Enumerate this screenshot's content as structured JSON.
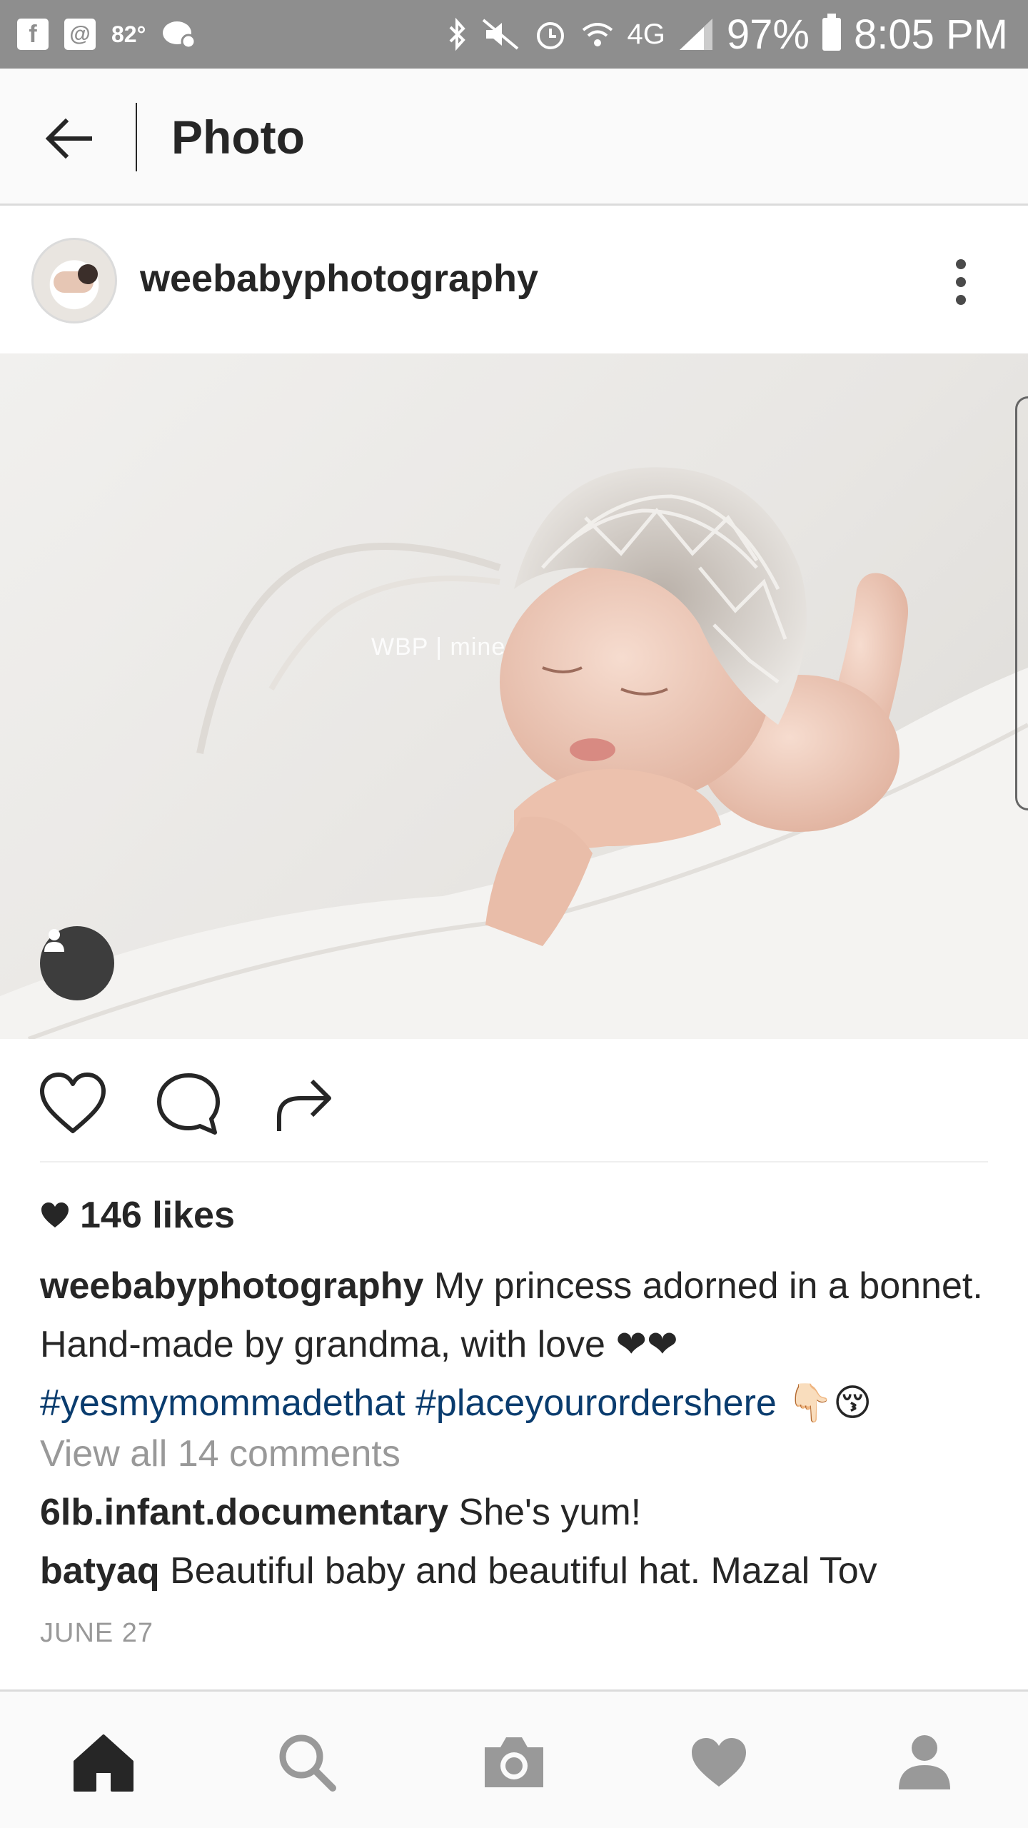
{
  "status_bar": {
    "temperature": "82°",
    "network": "4G",
    "battery": "97%",
    "time": "8:05 PM",
    "icons": [
      "facebook-icon",
      "email-icon",
      "weather-icon",
      "game-icon",
      "bluetooth-icon",
      "mute-icon",
      "alarm-icon",
      "wifi-icon",
      "signal-icon",
      "battery-icon"
    ]
  },
  "header": {
    "title": "Photo"
  },
  "post": {
    "username": "weebabyphotography",
    "photo_watermark": "WBP | mine",
    "likes": "146 likes",
    "caption": {
      "username": "weebabyphotography",
      "text": "My princess adorned in a bonnet.  Hand-made by grandma, with love ❤❤",
      "hashtags": [
        "#yesmymommadethat",
        "#placeyourordershere"
      ],
      "trailing_emoji": "👇🏻😚"
    },
    "view_comments": "View all 14 comments",
    "comments": [
      {
        "username": "6lb.infant.documentary",
        "text": "She's yum!"
      },
      {
        "username": "batyaq",
        "text": "Beautiful baby and beautiful hat.  Mazal Tov"
      }
    ],
    "date": "JUNE 27"
  },
  "colors": {
    "status_bar_bg": "#8e8e8e",
    "hashtag": "#0a3c6e",
    "muted_text": "#999999",
    "text": "#262626"
  },
  "bottom_nav": [
    "home-icon",
    "search-icon",
    "camera-icon",
    "heart-icon",
    "profile-icon"
  ]
}
